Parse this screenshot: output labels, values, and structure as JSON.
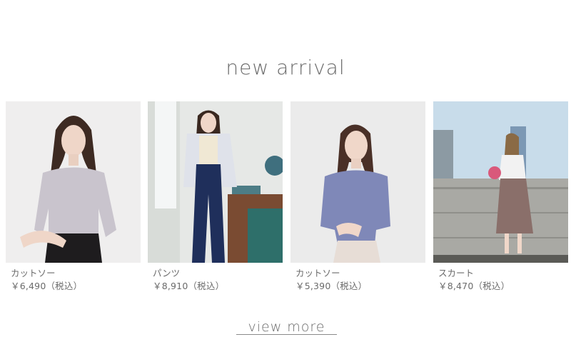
{
  "section": {
    "title": "new arrival"
  },
  "products": [
    {
      "category": "カットソー",
      "price": "￥6,490（税込）"
    },
    {
      "category": "パンツ",
      "price": "￥8,910（税込）"
    },
    {
      "category": "カットソー",
      "price": "￥5,390（税込）"
    },
    {
      "category": "スカート",
      "price": "￥8,470（税込）"
    }
  ],
  "footer": {
    "view_more_label": "view more"
  },
  "colors": {
    "text": "#6b6b6b",
    "background": "#ffffff"
  }
}
